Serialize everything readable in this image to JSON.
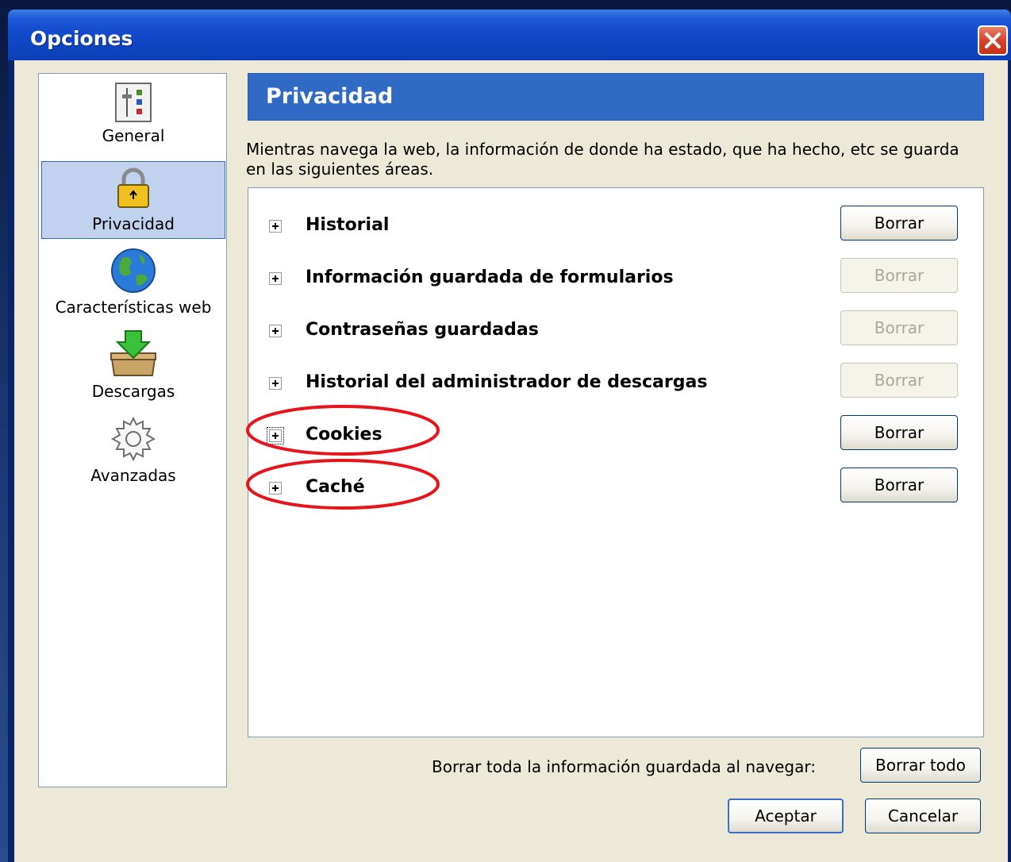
{
  "window": {
    "title": "Opciones"
  },
  "sidebar": {
    "items": [
      {
        "label": "General",
        "icon": "general-settings-icon"
      },
      {
        "label": "Privacidad",
        "icon": "padlock-icon",
        "selected": true
      },
      {
        "label": "Características web",
        "icon": "globe-icon"
      },
      {
        "label": "Descargas",
        "icon": "download-box-icon"
      },
      {
        "label": "Avanzadas",
        "icon": "gear-icon"
      }
    ]
  },
  "panel": {
    "title": "Privacidad",
    "description": "Mientras navega la web, la información de donde ha estado, que ha hecho, etc se guarda en las siguientes áreas."
  },
  "items": [
    {
      "label": "Historial",
      "button": "Borrar",
      "enabled": true
    },
    {
      "label": "Información guardada de formularios",
      "button": "Borrar",
      "enabled": false
    },
    {
      "label": "Contraseñas guardadas",
      "button": "Borrar",
      "enabled": false
    },
    {
      "label": "Historial del administrador de descargas",
      "button": "Borrar",
      "enabled": false
    },
    {
      "label": "Cookies",
      "button": "Borrar",
      "enabled": true,
      "highlighted": true
    },
    {
      "label": "Caché",
      "button": "Borrar",
      "enabled": true,
      "highlighted": true
    }
  ],
  "footer": {
    "clear_all_label": "Borrar toda la información guardada al navegar:",
    "clear_all_button": "Borrar todo",
    "ok_button": "Aceptar",
    "cancel_button": "Cancelar"
  },
  "colors": {
    "titlebar": "#0a3fb6",
    "header": "#316ac5",
    "selection": "#c1d2ee",
    "annotation": "#e8141c"
  }
}
